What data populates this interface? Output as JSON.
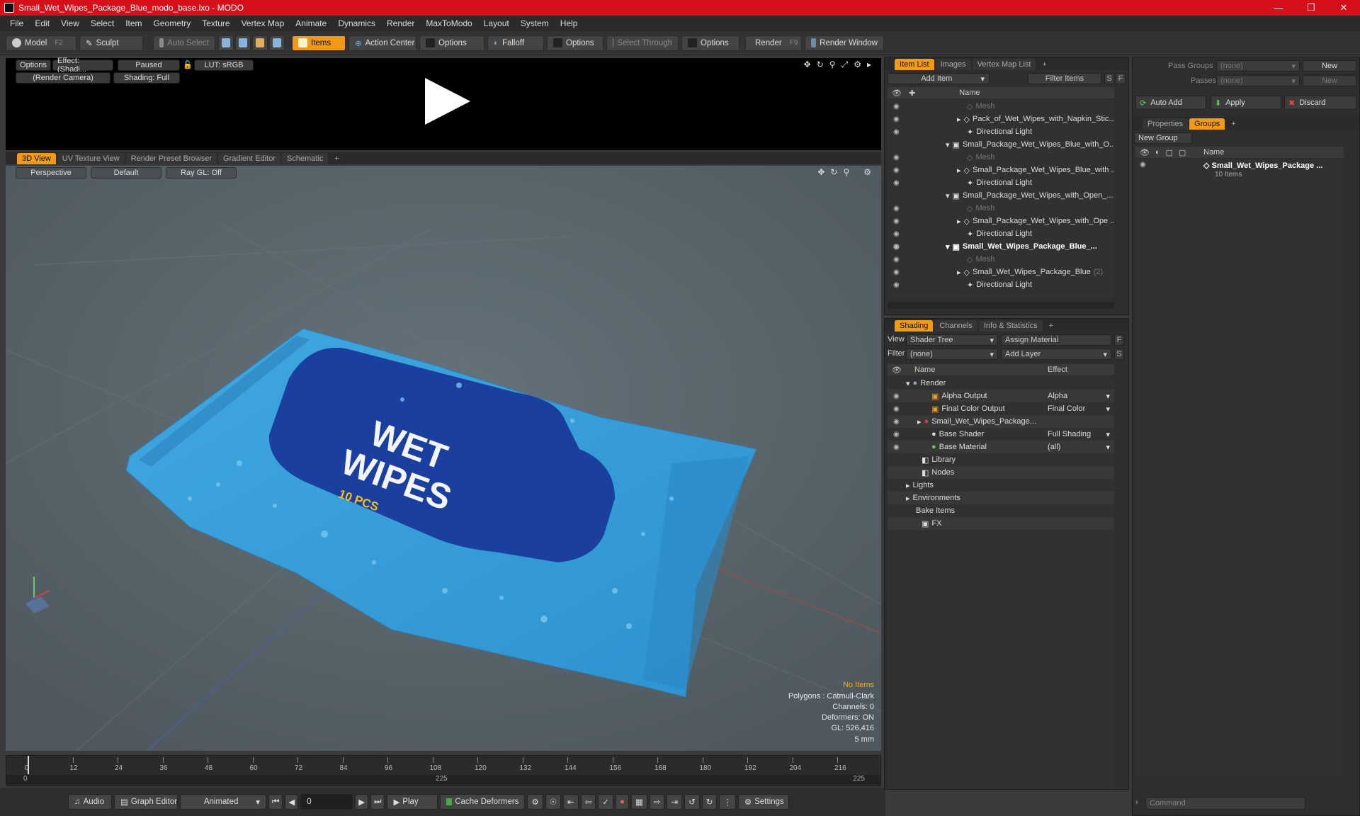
{
  "window": {
    "title": "Small_Wet_Wipes_Package_Blue_modo_base.lxo - MODO"
  },
  "menu": [
    "File",
    "Edit",
    "View",
    "Select",
    "Item",
    "Geometry",
    "Texture",
    "Vertex Map",
    "Animate",
    "Dynamics",
    "Render",
    "MaxToModo",
    "Layout",
    "System",
    "Help"
  ],
  "toolbar": {
    "model": "Model",
    "model_key": "F2",
    "sculpt": "Sculpt",
    "auto_select": "Auto Select",
    "items": "Items",
    "action_center": "Action Center",
    "options1": "Options",
    "falloff": "Falloff",
    "options2": "Options",
    "select_through": "Select Through",
    "options3": "Options",
    "render": "Render",
    "render_key": "F9",
    "render_window": "Render Window"
  },
  "render_view": {
    "options": "Options",
    "effect": "Effect: (Shadi...",
    "paused": "Paused",
    "lut": "LUT: sRGB",
    "camera": "(Render Camera)",
    "shading": "Shading: Full"
  },
  "view_tabs": [
    "3D View",
    "UV Texture View",
    "Render Preset Browser",
    "Gradient Editor",
    "Schematic",
    "+"
  ],
  "viewport": {
    "perspective": "Perspective",
    "default": "Default",
    "raygl": "Ray GL: Off",
    "package_line1": "WET",
    "package_line2": "WIPES",
    "package_count": "10 PCS"
  },
  "stats": {
    "no_items": "No Items",
    "polygons": "Polygons : Catmull-Clark",
    "channels": "Channels: 0",
    "deformers": "Deformers: ON",
    "gl": "GL: 526,416",
    "unit": "5 mm"
  },
  "timeline": {
    "ticks": [
      "0",
      "12",
      "24",
      "36",
      "48",
      "60",
      "72",
      "84",
      "96",
      "108",
      "120",
      "132",
      "144",
      "156",
      "168",
      "180",
      "192",
      "204",
      "216"
    ],
    "start": "0",
    "mid": "225",
    "end": "225"
  },
  "bottom": {
    "audio": "Audio",
    "graph_editor": "Graph Editor",
    "animated": "Animated",
    "frame": "0",
    "play": "Play",
    "cache": "Cache Deformers",
    "settings": "Settings"
  },
  "item_list": {
    "tabs": [
      "Item List",
      "Images",
      "Vertex Map List",
      "+"
    ],
    "add_item": "Add Item",
    "filter": "Filter Items",
    "s": "S",
    "f": "F",
    "col_name": "Name",
    "rows": [
      {
        "label": "Mesh",
        "dim": true
      },
      {
        "label": "Pack_of_Wet_Wipes_with_Napkin_Stic...",
        "dim": false
      },
      {
        "label": "Directional Light",
        "dim": false
      },
      {
        "label": "Small_Package_Wet_Wipes_Blue_with_O...",
        "dim": false
      },
      {
        "label": "Mesh",
        "dim": true
      },
      {
        "label": "Small_Package_Wet_Wipes_Blue_with ...",
        "dim": false
      },
      {
        "label": "Directional Light",
        "dim": false
      },
      {
        "label": "Small_Package_Wet_Wipes_with_Open_...",
        "dim": false
      },
      {
        "label": "Mesh",
        "dim": true
      },
      {
        "label": "Small_Package_Wet_Wipes_with_Ope ...",
        "dim": false
      },
      {
        "label": "Directional Light",
        "dim": false
      },
      {
        "label": "Small_Wet_Wipes_Package_Blue_...",
        "dim": false
      },
      {
        "label": "Mesh",
        "dim": true
      },
      {
        "label": "Small_Wet_Wipes_Package_Blue",
        "dim": false
      },
      {
        "label": "Directional Light",
        "dim": false
      }
    ],
    "count_badge": "(2)"
  },
  "shading": {
    "tabs": [
      "Shading",
      "Channels",
      "Info & Statistics",
      "+"
    ],
    "view_label": "View",
    "view_value": "Shader Tree",
    "assign": "Assign Material",
    "f": "F",
    "filter_label": "Filter",
    "filter_value": "(none)",
    "add_layer": "Add Layer",
    "s": "S",
    "col_name": "Name",
    "col_effect": "Effect",
    "rows": [
      {
        "name": "Render",
        "effect": ""
      },
      {
        "name": "Alpha Output",
        "effect": "Alpha"
      },
      {
        "name": "Final Color Output",
        "effect": "Final Color"
      },
      {
        "name": "Small_Wet_Wipes_Package...",
        "effect": ""
      },
      {
        "name": "Base Shader",
        "effect": "Full Shading"
      },
      {
        "name": "Base Material",
        "effect": "(all)"
      },
      {
        "name": "Library",
        "effect": ""
      },
      {
        "name": "Nodes",
        "effect": ""
      },
      {
        "name": "Lights",
        "effect": ""
      },
      {
        "name": "Environments",
        "effect": ""
      },
      {
        "name": "Bake Items",
        "effect": ""
      },
      {
        "name": "FX",
        "effect": ""
      }
    ]
  },
  "right": {
    "pass_groups": "Pass Groups",
    "passes": "Passes",
    "none": "(none)",
    "new": "New",
    "auto_add": "Auto Add",
    "apply": "Apply",
    "discard": "Discard",
    "tabs": [
      "Properties",
      "Groups",
      "+"
    ],
    "new_group": "New Group",
    "col_name": "Name",
    "group_name": "Small_Wet_Wipes_Package ...",
    "group_items": "10 Items",
    "command": "Command"
  }
}
